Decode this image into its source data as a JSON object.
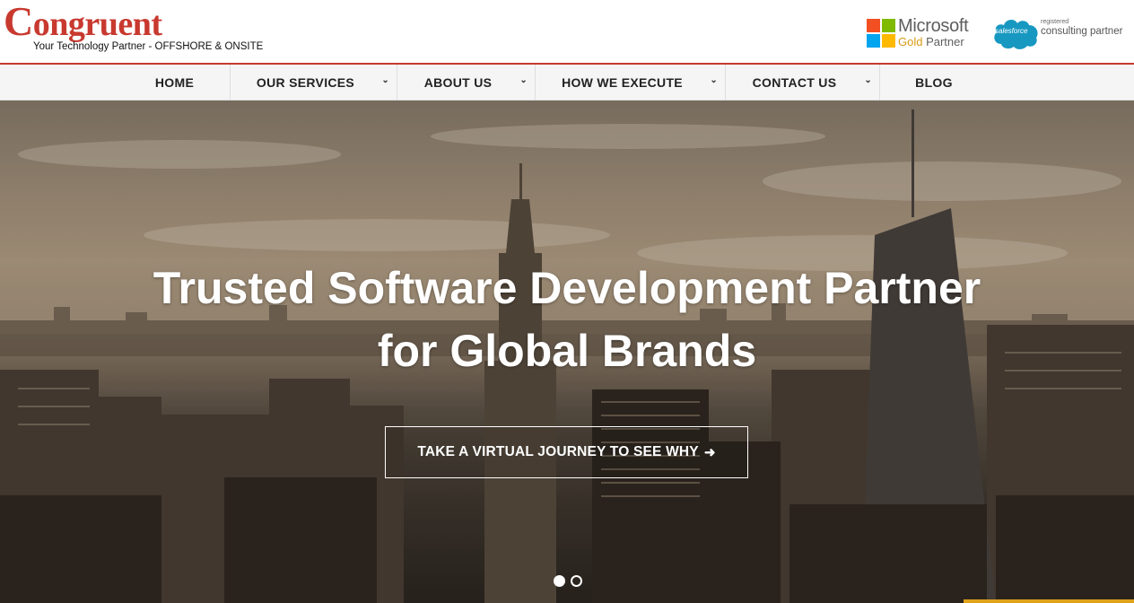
{
  "brand": {
    "name_initial": "C",
    "name_rest": "ongruent",
    "tagline": "Your Technology Partner - OFFSHORE & ONSITE"
  },
  "partners": {
    "microsoft": {
      "line1": "Microsoft",
      "line2_gold": "Gold",
      "line2_rest": " Partner",
      "colors": [
        "#f25022",
        "#7fba00",
        "#00a4ef",
        "#ffb900"
      ]
    },
    "salesforce": {
      "cloud_label": "salesforce",
      "registered": "registered",
      "line": "consulting partner",
      "color": "#1798c1"
    }
  },
  "nav": {
    "items": [
      {
        "label": "HOME",
        "has_dropdown": false
      },
      {
        "label": "OUR SERVICES",
        "has_dropdown": true
      },
      {
        "label": "ABOUT US",
        "has_dropdown": true
      },
      {
        "label": "HOW WE EXECUTE",
        "has_dropdown": true
      },
      {
        "label": "CONTACT US",
        "has_dropdown": true
      },
      {
        "label": "BLOG",
        "has_dropdown": false
      }
    ],
    "dropdown_icon": "chevron-down-icon"
  },
  "hero": {
    "headline_line1": "Trusted Software Development Partner",
    "headline_line2": "for Global Brands",
    "cta_label": "TAKE A VIRTUAL JOURNEY TO SEE WHY",
    "cta_icon": "arrow-right-icon",
    "slides": 2,
    "active_slide": 1
  },
  "colors": {
    "brand_red": "#c8392f",
    "accent_gold": "#e0a21b"
  }
}
